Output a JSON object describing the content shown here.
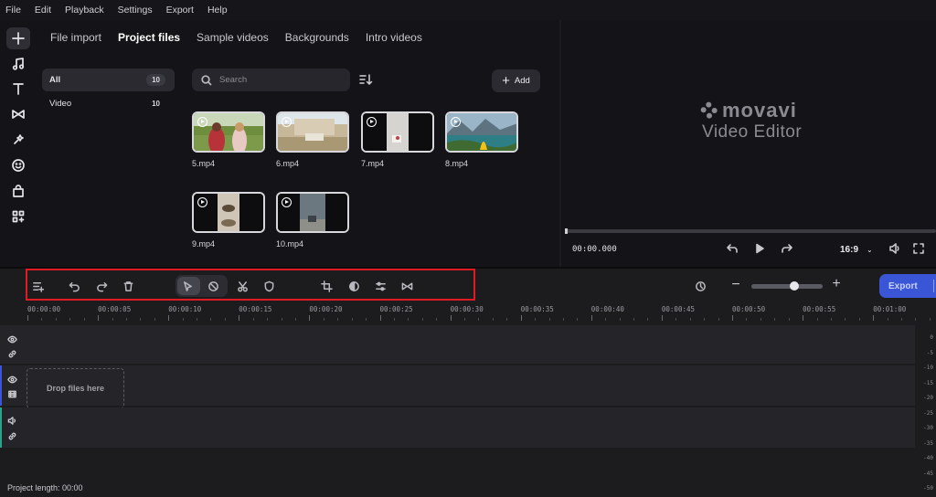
{
  "menu": [
    "File",
    "Edit",
    "Playback",
    "Settings",
    "Export",
    "Help"
  ],
  "rail": {
    "icons": [
      "plus-icon",
      "music-note-icon",
      "text-icon",
      "transitions-icon",
      "sparkle-icon",
      "sticker-icon",
      "store-icon",
      "apps-icon"
    ]
  },
  "import_tabs": [
    {
      "label": "File import",
      "active": false
    },
    {
      "label": "Project files",
      "active": true
    },
    {
      "label": "Sample videos",
      "active": false
    },
    {
      "label": "Backgrounds",
      "active": false
    },
    {
      "label": "Intro videos",
      "active": false
    }
  ],
  "categories": [
    {
      "label": "All",
      "count": "10",
      "active": true
    },
    {
      "label": "Video",
      "count": "10",
      "active": false
    }
  ],
  "search": {
    "placeholder": "Search"
  },
  "add_button": {
    "label": "Add"
  },
  "files": [
    {
      "name": "5.mp4",
      "thumb": "girls-field"
    },
    {
      "name": "6.mp4",
      "thumb": "building"
    },
    {
      "name": "7.mp4",
      "thumb": "cup"
    },
    {
      "name": "8.mp4",
      "thumb": "lake"
    },
    {
      "name": "9.mp4",
      "thumb": "bowls"
    },
    {
      "name": "10.mp4",
      "thumb": "room"
    }
  ],
  "preview": {
    "logo_brand": "movavi",
    "logo_sub": "Video Editor",
    "timecode": "00:00.000",
    "aspect_ratio": "16:9"
  },
  "timeline": {
    "export_label": "Export",
    "zoom_level": 0.6,
    "ruler": [
      "00:00:00",
      "00:00:05",
      "00:00:10",
      "00:00:15",
      "00:00:20",
      "00:00:25",
      "00:00:30",
      "00:00:35",
      "00:00:40",
      "00:00:45",
      "00:00:50",
      "00:00:55",
      "00:01:00"
    ],
    "drop_text": "Drop files here",
    "meter": [
      "0",
      "-5",
      "-10",
      "-15",
      "-20",
      "-25",
      "-30",
      "-35",
      "-40",
      "-45",
      "-50"
    ]
  },
  "status": {
    "project_length": "Project length: 00:00"
  },
  "colors": {
    "accent": "#3a55d6",
    "highlight": "#e01b24"
  }
}
